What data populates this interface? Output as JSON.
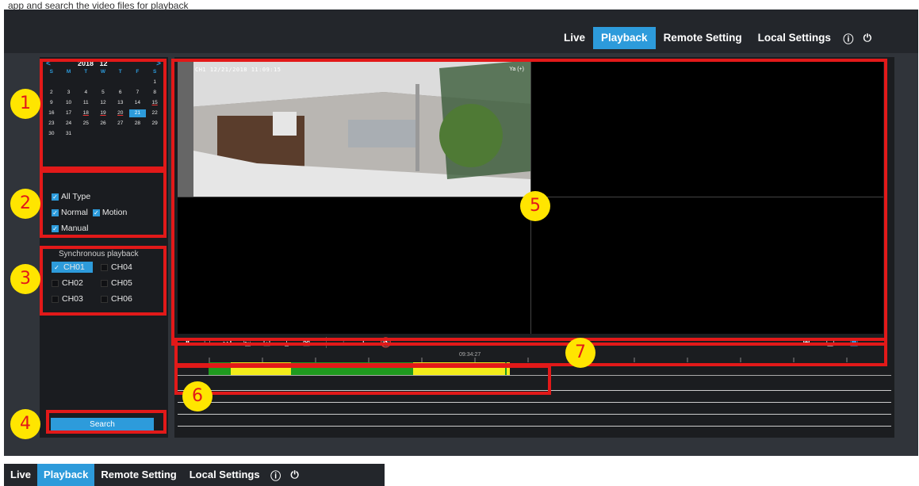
{
  "caption": "app   and search the video files for playback",
  "nav": {
    "live": "Live",
    "playback": "Playback",
    "remote": "Remote Setting",
    "local": "Local Settings",
    "info_icon": "info-icon",
    "power_icon": "power-icon"
  },
  "calendar": {
    "prev": "<",
    "next": ">",
    "year": "2018",
    "month": "12",
    "dow": [
      "S",
      "M",
      "T",
      "W",
      "T",
      "F",
      "S"
    ],
    "cells": [
      "",
      "",
      "",
      "",
      "",
      "",
      "1",
      "2",
      "3",
      "4",
      "5",
      "6",
      "7",
      "8",
      "9",
      "10",
      "11",
      "12",
      "13",
      "14",
      "15",
      "16",
      "17",
      "18",
      "19",
      "20",
      "21",
      "22",
      "23",
      "24",
      "25",
      "26",
      "27",
      "28",
      "29",
      "30",
      "31",
      "",
      "",
      "",
      "",
      ""
    ],
    "recorded_days": [
      "15",
      "18",
      "19",
      "20"
    ],
    "selected_day": "21"
  },
  "filters": {
    "all": "All Type",
    "normal": "Normal",
    "motion": "Motion",
    "manual": "Manual"
  },
  "sync_label": "Synchronous playback",
  "channels": [
    "CH01",
    "CH04",
    "CH02",
    "CH05",
    "CH03",
    "CH06"
  ],
  "selected_channel": "CH01",
  "search_label": "Search",
  "osd": {
    "left": "CH1 12/21/2018 11:09:15",
    "right": "Ya (+)"
  },
  "timeline_time": "09:34:27",
  "annotations": [
    "1",
    "2",
    "3",
    "4",
    "5",
    "6",
    "7"
  ],
  "colors": {
    "accent": "#2d9bdb",
    "normal_rec": "#1f9a1f",
    "motion_rec": "#f2ec1a",
    "annot_red": "#e21919",
    "annot_yellow": "#ffe500"
  }
}
